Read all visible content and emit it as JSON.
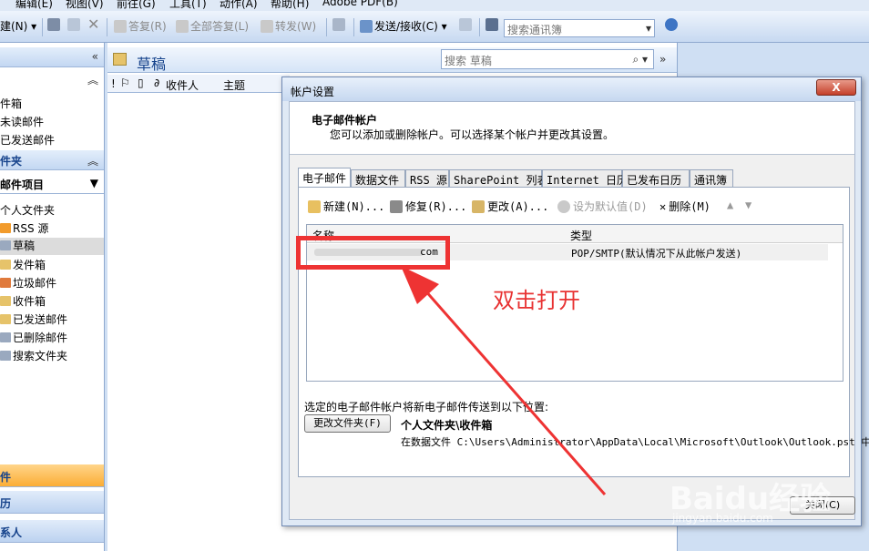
{
  "menu": {
    "items": [
      "编辑(E)",
      "视图(V)",
      "前往(G)",
      "工具(T)",
      "动作(A)",
      "帮助(H)",
      "Adobe PDF(B)"
    ]
  },
  "toolbar": {
    "new_label": "建(N)",
    "reply": "答复(R)",
    "reply_all": "全部答复(L)",
    "forward": "转发(W)",
    "send_receive": "发送/接收(C)",
    "search_address_placeholder": "搜索通讯簿"
  },
  "nav": {
    "mail_items": [
      "件箱",
      "未读邮件",
      "已发送邮件"
    ],
    "folders_header": "件夹",
    "all_items": "邮件项目",
    "tree": [
      "个人文件夹",
      "RSS 源",
      "草稿",
      "发件箱",
      "垃圾邮件",
      "收件箱",
      "已发送邮件",
      "已删除邮件",
      "搜索文件夹"
    ],
    "buttons": [
      "件",
      "历",
      "系人"
    ]
  },
  "main": {
    "title": "草稿",
    "search_placeholder": "搜索 草稿",
    "columns": [
      "!",
      "收件人",
      "主题"
    ]
  },
  "dialog": {
    "title": "帐户设置",
    "close": "X",
    "heading": "电子邮件帐户",
    "description": "您可以添加或删除帐户。可以选择某个帐户并更改其设置。",
    "tabs": [
      "电子邮件",
      "数据文件",
      "RSS 源",
      "SharePoint 列表",
      "Internet 日历",
      "已发布日历",
      "通讯簿"
    ],
    "toolbar": {
      "new": "新建(N)...",
      "repair": "修复(R)...",
      "change": "更改(A)...",
      "set_default": "设为默认值(D)",
      "delete": "删除(M)"
    },
    "list_headers": [
      "名称",
      "类型"
    ],
    "account": {
      "name_suffix": "com",
      "type": "POP/SMTP(默认情况下从此帐户发送)"
    },
    "deliver_label": "选定的电子邮件帐户将新电子邮件传送到以下位置:",
    "change_folder_button": "更改文件夹(F)",
    "folder": "个人文件夹\\收件箱",
    "path": "在数据文件 C:\\Users\\Administrator\\AppData\\Local\\Microsoft\\Outlook\\Outlook.pst 中",
    "close_button": "关闭(C)"
  },
  "annotation": {
    "text": "双击打开",
    "color": "#e83232"
  },
  "watermark": {
    "brand": "Baidu经验",
    "url": "jingyan.baidu.com"
  },
  "colors": {
    "accent": "#15428b",
    "annotation": "#ee3333",
    "active_nav": "#fbad35"
  }
}
